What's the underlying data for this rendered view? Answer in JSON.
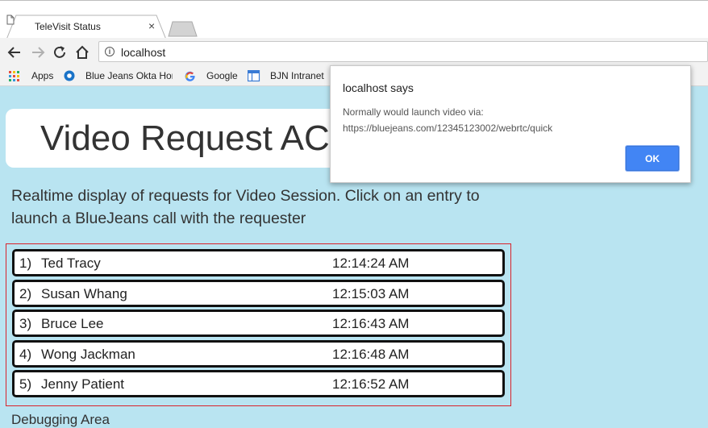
{
  "browser": {
    "tab_title": "TeleVisit Status",
    "tab_close": "×",
    "url": "localhost",
    "bookmarks": [
      {
        "label": "Apps",
        "icon": "apps-grid-icon"
      },
      {
        "label": "Blue Jeans Okta Hon",
        "icon": "okta-icon"
      },
      {
        "label": "Google",
        "icon": "google-icon"
      },
      {
        "label": "BJN Intranet",
        "icon": "intranet-icon"
      }
    ]
  },
  "page": {
    "title": "Video Request AC",
    "description": "Realtime display of requests for Video Session. Click on an entry to launch a BlueJeans call with the requester",
    "requests": [
      {
        "num": "1)",
        "name": "Ted Tracy",
        "time": "12:14:24 AM"
      },
      {
        "num": "2)",
        "name": "Susan Whang",
        "time": "12:15:03 AM"
      },
      {
        "num": "3)",
        "name": "Bruce Lee",
        "time": "12:16:43 AM"
      },
      {
        "num": "4)",
        "name": "Wong Jackman",
        "time": "12:16:48 AM"
      },
      {
        "num": "5)",
        "name": "Jenny Patient",
        "time": "12:16:52 AM"
      }
    ],
    "debug_heading": "Debugging Area"
  },
  "dialog": {
    "title": "localhost says",
    "message_line1": "Normally would launch video via:",
    "message_line2": "https://bluejeans.com/12345123002/webrtc/quick",
    "ok_label": "OK"
  },
  "colors": {
    "page_background": "#b9e4f1",
    "list_border": "#d9232b",
    "ok_button": "#4285f4"
  }
}
